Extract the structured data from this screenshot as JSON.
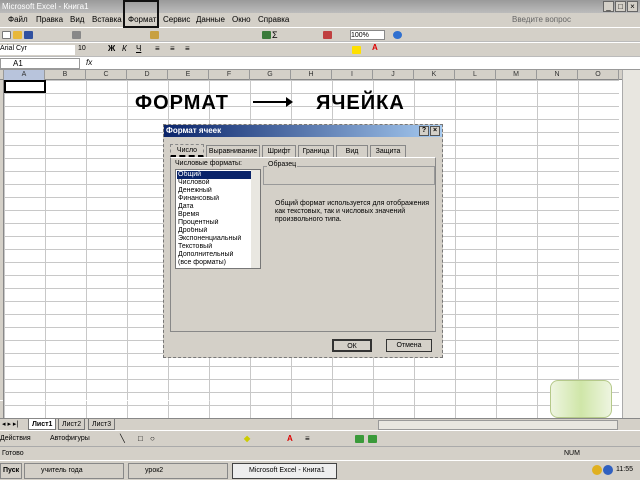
{
  "window": {
    "title": "Microsoft Excel - Книга1"
  },
  "menu": {
    "items": [
      "Файл",
      "Правка",
      "Вид",
      "Вставка",
      "Формат",
      "Сервис",
      "Данные",
      "Окно",
      "Справка"
    ],
    "help_search_placeholder": "Введите вопрос"
  },
  "toolbar": {
    "zoom": "100%",
    "font": "Arial Cyr",
    "font_size": "10",
    "bold": "Ж",
    "italic": "К",
    "underline": "Ч"
  },
  "formula_bar": {
    "name_box": "A1",
    "fx": "fx",
    "value": ""
  },
  "columns": [
    "A",
    "B",
    "C",
    "D",
    "E",
    "F",
    "G",
    "H",
    "I",
    "J",
    "K",
    "L",
    "M",
    "N",
    "O"
  ],
  "annotation": {
    "left": "ФОРМАТ",
    "right": "ЯЧЕЙКА"
  },
  "dialog": {
    "title": "Формат ячеек",
    "help": "?",
    "close": "×",
    "tabs": [
      "Число",
      "Выравнивание",
      "Шрифт",
      "Граница",
      "Вид",
      "Защита"
    ],
    "active_tab": "Число",
    "category_label": "Числовые форматы:",
    "categories": [
      "Общий",
      "Числовой",
      "Денежный",
      "Финансовый",
      "Дата",
      "Время",
      "Процентный",
      "Дробный",
      "Экспоненциальный",
      "Текстовый",
      "Дополнительный",
      "(все форматы)"
    ],
    "selected_category": "Общий",
    "sample_label": "Образец",
    "description": "Общий формат используется для отображения как текстовых, так и числовых значений произвольного типа.",
    "ok": "ОК",
    "cancel": "Отмена"
  },
  "sheets": [
    "Лист1",
    "Лист2",
    "Лист3"
  ],
  "drawing": {
    "draw": "Действия",
    "autoshapes": "Автофигуры"
  },
  "status": {
    "left": "Готово",
    "num": "NUM"
  },
  "taskbar": {
    "start": "Пуск",
    "items": [
      "учитель года",
      "урок2",
      "Microsoft Excel - Книга1"
    ],
    "clock": "11:55"
  }
}
